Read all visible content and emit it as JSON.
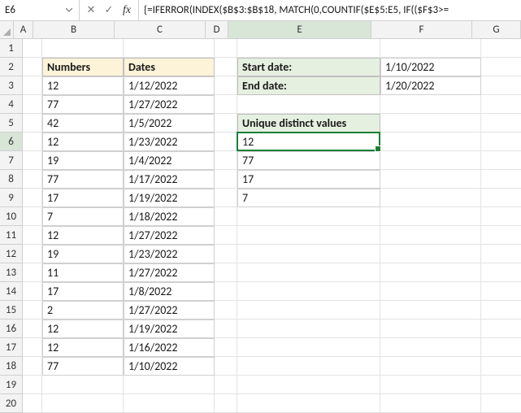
{
  "nameBox": "E6",
  "formula": "{=IFERROR(INDEX($B$3:$B$18, MATCH(0,COUNTIF($E$5:E5, IF(($F$3>=",
  "columns": [
    "A",
    "B",
    "C",
    "D",
    "E",
    "F",
    "G"
  ],
  "rowCount": 20,
  "activeCol": "E",
  "activeRow": 6,
  "headers": {
    "numbers": "Numbers",
    "dates": "Dates",
    "start": "Start date:",
    "end": "End date:",
    "unique": "Unique distinct values"
  },
  "dateRange": {
    "start": "1/10/2022",
    "end": "1/20/2022"
  },
  "tableBC": [
    {
      "n": "12",
      "d": "1/12/2022"
    },
    {
      "n": "77",
      "d": "1/27/2022"
    },
    {
      "n": "42",
      "d": "1/5/2022"
    },
    {
      "n": "12",
      "d": "1/23/2022"
    },
    {
      "n": "19",
      "d": "1/4/2022"
    },
    {
      "n": "77",
      "d": "1/17/2022"
    },
    {
      "n": "17",
      "d": "1/19/2022"
    },
    {
      "n": "7",
      "d": "1/18/2022"
    },
    {
      "n": "12",
      "d": "1/27/2022"
    },
    {
      "n": "19",
      "d": "1/23/2022"
    },
    {
      "n": "11",
      "d": "1/27/2022"
    },
    {
      "n": "17",
      "d": "1/8/2022"
    },
    {
      "n": "2",
      "d": "1/27/2022"
    },
    {
      "n": "12",
      "d": "1/19/2022"
    },
    {
      "n": "12",
      "d": "1/16/2022"
    },
    {
      "n": "77",
      "d": "1/10/2022"
    }
  ],
  "uniqueValues": [
    "12",
    "77",
    "17",
    "7"
  ],
  "icons": {
    "cancel": "✕",
    "enter": "✓",
    "fx": "fx"
  },
  "colWidths": {
    "A": 24,
    "B": 100,
    "C": 112,
    "D": 28,
    "E": 176,
    "F": 124,
    "G": 60
  }
}
